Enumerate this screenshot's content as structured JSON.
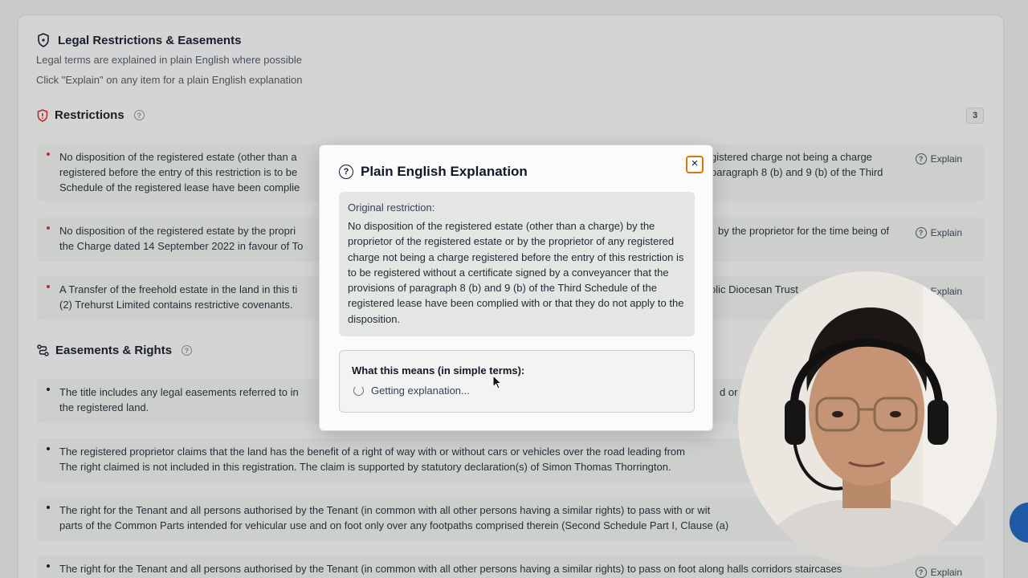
{
  "section": {
    "title": "Legal Restrictions & Easements",
    "subtitle1": "Legal terms are explained in plain English where possible",
    "subtitle2": "Click \"Explain\" on any item for a plain English explanation"
  },
  "restrictions": {
    "heading": "Restrictions",
    "count": "3",
    "items": [
      {
        "left": "No disposition of the registered estate (other than a",
        "right": "gistered charge not being a charge",
        "left2": "registered before the entry of this restriction is to be",
        "right2": "paragraph 8 (b) and 9 (b) of the Third",
        "left3": "Schedule of the registered lease have been complie",
        "explain": "Explain"
      },
      {
        "left": "No disposition of the registered estate by the propri",
        "right": "by the proprietor for the time being of",
        "left2": "the Charge dated 14 September 2022 in favour of To",
        "explain": "Explain"
      },
      {
        "left": "A Transfer of the freehold estate in the land in this ti",
        "right": "olic Diocesan Trust",
        "left2": "(2) Trehurst Limited contains restrictive covenants.",
        "explain": "Explain"
      }
    ]
  },
  "easements": {
    "heading": "Easements & Rights",
    "items": [
      {
        "line1": "The title includes any legal easements referred to in",
        "right": "d or re",
        "line2": "the registered land."
      },
      {
        "line1": "The registered proprietor claims that the land has the benefit of a right of way with or without cars or vehicles over the road leading from",
        "line2": "The right claimed is not included in this registration. The claim is supported by statutory declaration(s) of Simon Thomas Thorrington."
      },
      {
        "line1": "The right for the Tenant and all persons authorised by the Tenant (in common with all other persons having a similar rights) to pass with or wit",
        "line2": "parts of the Common Parts intended for vehicular use and on foot only over any footpaths comprised therein (Second Schedule Part I, Clause (a)"
      },
      {
        "line1": "The right for the Tenant and all persons authorised by the Tenant (in common with all other persons having a similar rights) to pass on foot along halls corridors staircases",
        "explain": "Explain"
      }
    ]
  },
  "modal": {
    "title": "Plain English Explanation",
    "close": "×",
    "original_label": "Original restriction:",
    "original_text": "No disposition of the registered estate (other than a charge) by the proprietor of the registered estate or by the proprietor of any registered charge not being a charge registered before the entry of this restriction is to be registered without a certificate signed by a conveyancer that the provisions of paragraph 8 (b) and 9 (b) of the Third Schedule of the registered lease have been complied with or that they do not apply to the disposition.",
    "means_label": "What this means (in simple terms):",
    "loading_text": "Getting explanation..."
  },
  "icons": {
    "shield": "shield-icon",
    "help": "help-circle-icon",
    "close": "close-icon",
    "spinner": "spinner-icon",
    "easement": "route-icon"
  },
  "colors": {
    "accent_red": "#dc2626",
    "focus_ring": "#d97706"
  }
}
